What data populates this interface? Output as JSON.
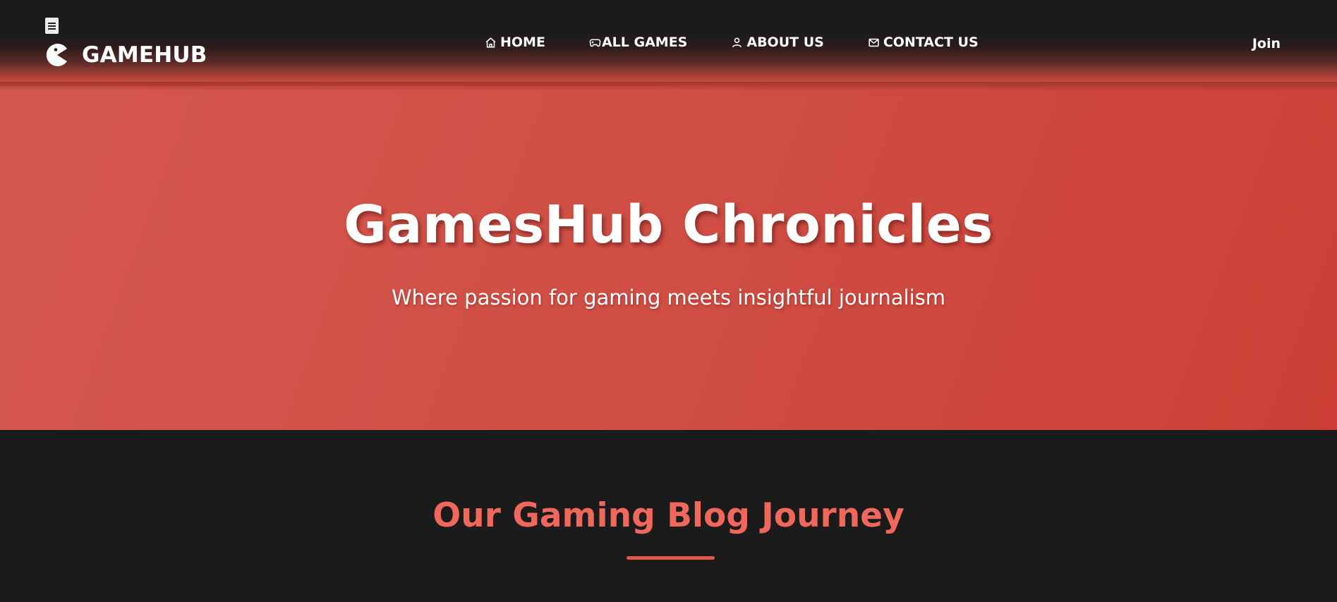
{
  "header": {
    "brand": "GAMEHUB",
    "nav": [
      {
        "label": "HOME",
        "icon": "home-icon"
      },
      {
        "label": "ALL GAMES",
        "icon": "gamepad-icon"
      },
      {
        "label": "ABOUT US",
        "icon": "user-icon"
      },
      {
        "label": "CONTACT US",
        "icon": "mail-icon"
      }
    ],
    "join_label": "Join"
  },
  "hero": {
    "title": "GamesHub Chronicles",
    "subtitle": "Where passion for gaming meets insightful journalism"
  },
  "section": {
    "title": "Our Gaming Blog Journey"
  },
  "colors": {
    "header_bg": "#1c1b1c",
    "hero_red": "#d0483f",
    "accent": "#f0685b",
    "page_bg": "#1c1b1c"
  }
}
